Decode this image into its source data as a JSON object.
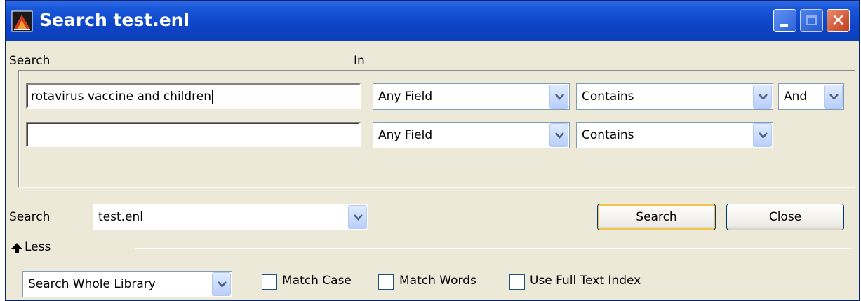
{
  "window": {
    "title": "Search test.enl",
    "colors": {
      "titlebar": "#0a3fb8",
      "face": "#ece9d8",
      "close": "#c0391a"
    }
  },
  "criteria": {
    "search_label": "Search",
    "in_label": "In",
    "rows": [
      {
        "term": "rotavirus vaccine and children",
        "field": "Any Field",
        "operator": "Contains",
        "boolean": "And"
      },
      {
        "term": "",
        "field": "Any Field",
        "operator": "Contains"
      }
    ]
  },
  "scope": {
    "label": "Search",
    "library": "test.enl"
  },
  "buttons": {
    "search": "Search",
    "close": "Close"
  },
  "less_label": "Less",
  "options": {
    "range": "Search Whole Library",
    "match_case": "Match Case",
    "match_words": "Match Words",
    "full_text": "Use Full Text Index"
  },
  "icons": [
    "app-icon",
    "minimize-icon",
    "maximize-icon",
    "close-icon",
    "chevron-down-icon",
    "less-arrow-icon"
  ]
}
